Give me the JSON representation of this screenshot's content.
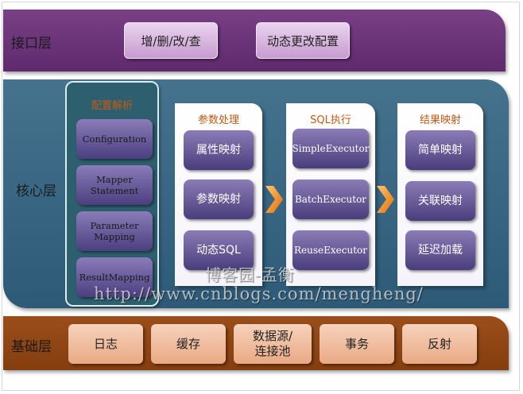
{
  "interface_layer": {
    "label": "接口层",
    "items": [
      "增/删/改/查",
      "动态更改配置"
    ]
  },
  "core_layer": {
    "label": "核心层",
    "config_panel": {
      "title": "配置解析",
      "items": [
        "Configuration",
        "Mapper Statement",
        "Parameter Mapping",
        "ResultMapping"
      ]
    },
    "param_panel": {
      "title": "参数处理",
      "items": [
        "属性映射",
        "参数映射",
        "动态SQL"
      ]
    },
    "sql_panel": {
      "title": "SQL执行",
      "items": [
        "SimpleExecutor",
        "BatchExecutor",
        "ReuseExecutor"
      ]
    },
    "result_panel": {
      "title": "结果映射",
      "items": [
        "简单映射",
        "关联映射",
        "延迟加载"
      ]
    }
  },
  "base_layer": {
    "label": "基础层",
    "items": [
      "日志",
      "缓存",
      "数据源/\n连接池",
      "事务",
      "反射"
    ]
  },
  "watermark": {
    "line1": "博客园-孟衡",
    "line2": "http://www.cnblogs.com/mengheng/"
  }
}
